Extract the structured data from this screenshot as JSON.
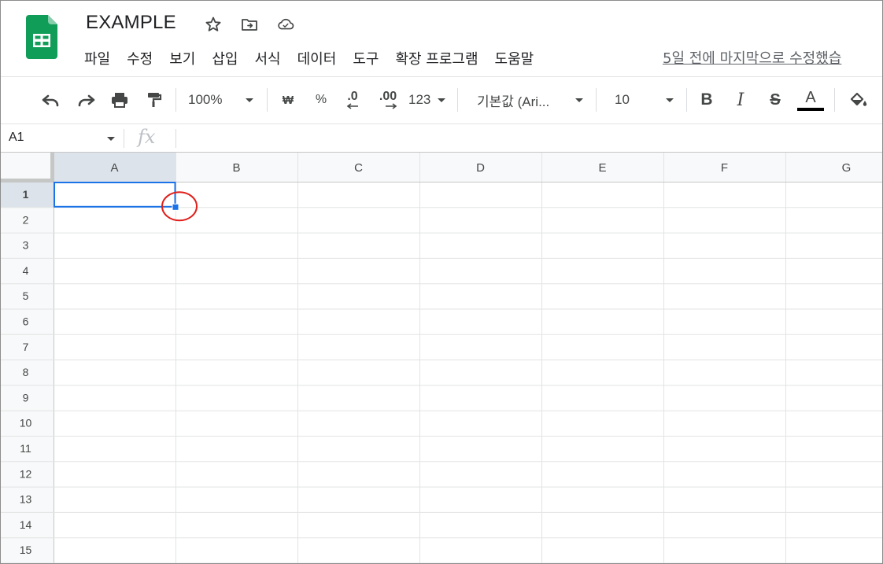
{
  "app": {
    "title": "EXAMPLE",
    "last_edit": "5일 전에 마지막으로 수정했습"
  },
  "menu": [
    "파일",
    "수정",
    "보기",
    "삽입",
    "서식",
    "데이터",
    "도구",
    "확장 프로그램",
    "도움말"
  ],
  "toolbar": {
    "zoom": "100%",
    "currency": "₩",
    "percent": "%",
    "decimal_decrease": ".0",
    "decimal_increase": ".00",
    "number_format": "123",
    "font": "기본값 (Ari...",
    "font_size": "10",
    "bold": "B",
    "italic": "I",
    "strike": "S",
    "text_color_letter": "A"
  },
  "formula_bar": {
    "cell_ref": "A1",
    "fx_label": "fx"
  },
  "sheet": {
    "columns": [
      "A",
      "B",
      "C",
      "D",
      "E",
      "F",
      "G"
    ],
    "rows": [
      "1",
      "2",
      "3",
      "4",
      "5",
      "6",
      "7",
      "8",
      "9",
      "10",
      "11",
      "12",
      "13",
      "14",
      "15"
    ],
    "selected_cell": "A1"
  },
  "colors": {
    "logo_green": "#0f9d58",
    "selection_blue": "#1a73e8",
    "annotation_red": "#e0201b",
    "header_bg": "#f8f9fa",
    "grid_line": "#e2e3e3"
  }
}
